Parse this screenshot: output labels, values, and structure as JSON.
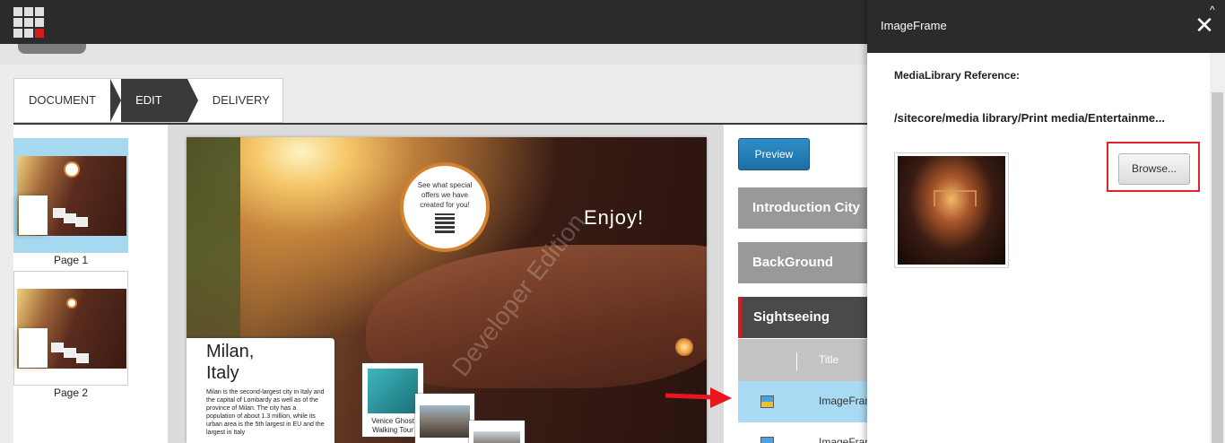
{
  "workflow": {
    "steps": [
      "DOCUMENT",
      "EDIT",
      "DELIVERY"
    ],
    "active": "EDIT"
  },
  "pages": [
    {
      "label": "Page 1",
      "selected": true
    },
    {
      "label": "Page 2",
      "selected": false
    }
  ],
  "document_page": {
    "bubble_text": "See what special offers we have created for you!",
    "enjoy_text": "Enjoy!",
    "city_title_line1": "Milan,",
    "city_title_line2": "Italy",
    "city_body": "Milan is the second-largest city in Italy and the capital of Lombardy as well as of the province of Milan. The city has a population of about 1.3 million, while its urban area is the 5th largest in EU and the largest in Italy",
    "photo_caption": "Venice Ghost Walking Tour",
    "watermark": "Developer Edition"
  },
  "editor": {
    "preview_label": "Preview",
    "sections": [
      {
        "label": "Introduction City",
        "open": false
      },
      {
        "label": "BackGround",
        "open": false
      },
      {
        "label": "Sightseeing",
        "open": true
      }
    ],
    "grid_column": "Title",
    "rows": [
      {
        "title": "ImageFrame",
        "selected": true
      },
      {
        "title": "ImageFrame",
        "selected": false
      }
    ]
  },
  "panel": {
    "title": "ImageFrame",
    "reference_label": "MediaLibrary Reference:",
    "reference_path": "/sitecore/media library/Print media/Entertainme...",
    "browse_label": "Browse..."
  },
  "colors": {
    "accent": "#d51d1d",
    "topbar": "#2b2b2b",
    "preview": "#1d6fa5",
    "selection": "#a9daf3"
  }
}
